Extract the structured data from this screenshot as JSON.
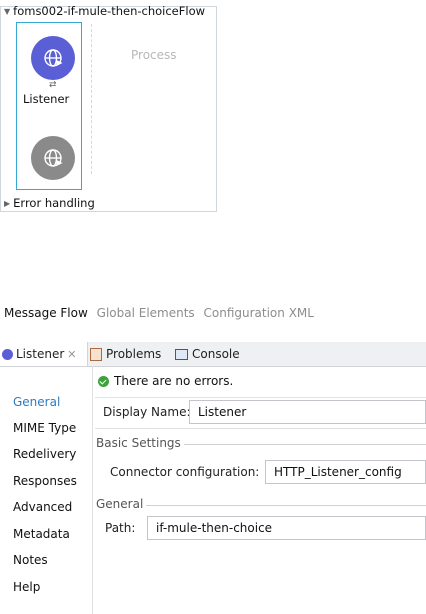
{
  "flow": {
    "title": "foms002-if-mule-then-choiceFlow",
    "process_label": "Process",
    "source_label": "Listener",
    "error_handling": "Error handling"
  },
  "editor_tabs": [
    "Message Flow",
    "Global Elements",
    "Configuration XML"
  ],
  "panel_tabs": {
    "listener": "Listener",
    "problems": "Problems",
    "console": "Console"
  },
  "nav": [
    "General",
    "MIME Type",
    "Redelivery",
    "Responses",
    "Advanced",
    "Metadata",
    "Notes",
    "Help"
  ],
  "status": "There are no errors.",
  "form": {
    "display_name_label": "Display Name:",
    "display_name_value": "Listener",
    "basic_settings_title": "Basic Settings",
    "connector_label": "Connector configuration:",
    "connector_value": "HTTP_Listener_config",
    "general_title": "General",
    "path_label": "Path:",
    "path_value": "if-mule-then-choice"
  },
  "colors": {
    "listener_circle": "#5a5fd6",
    "disabled_circle": "#8a8a8a",
    "selection_border": "#35a8d4",
    "active_nav": "#2f7bbf"
  }
}
